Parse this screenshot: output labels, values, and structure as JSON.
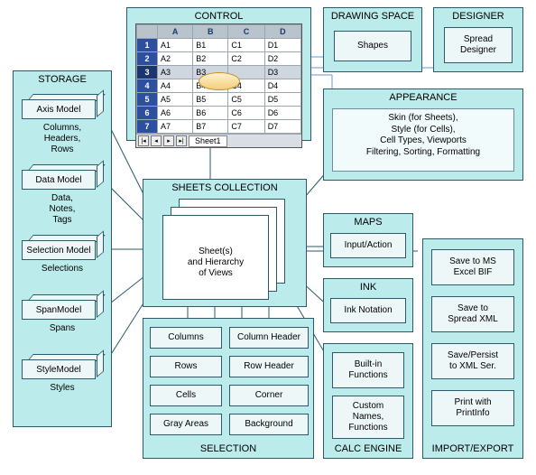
{
  "storage": {
    "title": "STORAGE",
    "items": [
      {
        "label": "Axis Model",
        "sub": "Columns,\nHeaders,\nRows"
      },
      {
        "label": "Data Model",
        "sub": "Data,\nNotes,\nTags"
      },
      {
        "label": "Selection Model",
        "sub": "Selections"
      },
      {
        "label": "SpanModel",
        "sub": "Spans"
      },
      {
        "label": "StyleModel",
        "sub": "Styles"
      }
    ]
  },
  "control": {
    "title": "CONTROL",
    "grid_columns": [
      "A",
      "B",
      "C",
      "D"
    ],
    "rows": [
      [
        "A1",
        "B1",
        "C1",
        "D1"
      ],
      [
        "A2",
        "B2",
        "C2",
        "D2"
      ],
      [
        "A3",
        "B3",
        "",
        "D3"
      ],
      [
        "A4",
        "B4",
        "C4",
        "D4"
      ],
      [
        "A5",
        "B5",
        "C5",
        "D5"
      ],
      [
        "A6",
        "B6",
        "C6",
        "D6"
      ],
      [
        "A7",
        "B7",
        "C7",
        "D7"
      ]
    ],
    "selected_row_index": 2,
    "sheet_tab": "Sheet1"
  },
  "drawing_space": {
    "title": "DRAWING SPACE",
    "box": "Shapes"
  },
  "designer": {
    "title": "DESIGNER",
    "box": "Spread\nDesigner"
  },
  "appearance": {
    "title": "APPEARANCE",
    "text": "Skin (for Sheets),\nStyle (for Cells),\nCell Types, Viewports\nFiltering, Sorting, Formatting"
  },
  "sheets_collection": {
    "title": "SHEETS COLLECTION",
    "doc_label": "Sheet(s)\nand Hierarchy\nof Views"
  },
  "maps": {
    "title": "MAPS",
    "box": "Input/Action"
  },
  "ink": {
    "title": "INK",
    "box": "Ink Notation"
  },
  "calc_engine": {
    "title": "CALC ENGINE",
    "boxes": [
      "Built-in\nFunctions",
      "Custom\nNames,\nFunctions"
    ]
  },
  "import_export": {
    "title": "IMPORT/EXPORT",
    "boxes": [
      "Save to MS\nExcel BIF",
      "Save to\nSpread XML",
      "Save/Persist\nto XML Ser.",
      "Print with\nPrintInfo"
    ]
  },
  "selection": {
    "title": "SELECTION",
    "boxes": [
      [
        "Columns",
        "Column Header"
      ],
      [
        "Rows",
        "Row Header"
      ],
      [
        "Cells",
        "Corner"
      ],
      [
        "Gray Areas",
        "Background"
      ]
    ]
  }
}
